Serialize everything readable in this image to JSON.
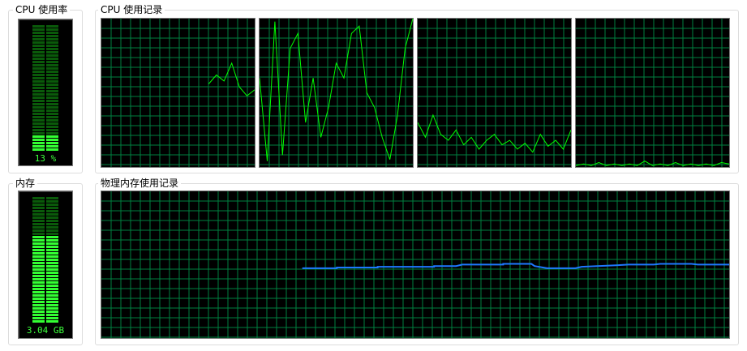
{
  "colors": {
    "background": "#000000",
    "grid": "#008040",
    "cpu_line": "#00ff00",
    "meter_on": "#33ff33",
    "meter_off": "#0a5a0a",
    "memory_line": "#1e78ff"
  },
  "cpu_usage": {
    "label": "CPU 使用率",
    "value_text": "13 %",
    "fraction": 0.13
  },
  "cpu_history": {
    "label": "CPU 使用记录"
  },
  "memory": {
    "label": "内存",
    "value_text": "3.04 GB",
    "fraction": 0.68
  },
  "memory_history": {
    "label": "物理内存使用记录"
  },
  "chart_data": [
    {
      "type": "line",
      "name": "cpu-core-1",
      "ylim": [
        0,
        100
      ],
      "x": [
        0,
        1,
        2,
        3,
        4,
        5,
        6,
        7,
        8,
        9,
        10,
        11,
        12,
        13,
        14,
        15,
        16,
        17,
        18,
        19,
        20
      ],
      "values": [
        null,
        null,
        null,
        null,
        null,
        null,
        null,
        null,
        null,
        null,
        null,
        null,
        null,
        null,
        56,
        62,
        58,
        70,
        54,
        48,
        52
      ]
    },
    {
      "type": "line",
      "name": "cpu-core-2",
      "ylim": [
        0,
        100
      ],
      "x": [
        0,
        1,
        2,
        3,
        4,
        5,
        6,
        7,
        8,
        9,
        10,
        11,
        12,
        13,
        14,
        15,
        16,
        17,
        18,
        19,
        20
      ],
      "values": [
        60,
        4,
        98,
        8,
        80,
        90,
        30,
        60,
        20,
        40,
        70,
        60,
        90,
        95,
        50,
        40,
        20,
        5,
        35,
        80,
        100
      ]
    },
    {
      "type": "line",
      "name": "cpu-core-3",
      "ylim": [
        0,
        100
      ],
      "x": [
        0,
        1,
        2,
        3,
        4,
        5,
        6,
        7,
        8,
        9,
        10,
        11,
        12,
        13,
        14,
        15,
        16,
        17,
        18,
        19,
        20
      ],
      "values": [
        30,
        20,
        35,
        22,
        18,
        25,
        15,
        20,
        12,
        18,
        22,
        15,
        18,
        12,
        16,
        10,
        22,
        14,
        18,
        12,
        25
      ]
    },
    {
      "type": "line",
      "name": "cpu-core-4",
      "ylim": [
        0,
        100
      ],
      "x": [
        0,
        1,
        2,
        3,
        4,
        5,
        6,
        7,
        8,
        9,
        10,
        11,
        12,
        13,
        14,
        15,
        16,
        17,
        18,
        19,
        20
      ],
      "values": [
        1,
        2,
        1,
        3,
        1,
        2,
        1,
        2,
        1,
        4,
        1,
        2,
        1,
        3,
        1,
        2,
        1,
        2,
        1,
        3,
        2
      ]
    },
    {
      "type": "line",
      "name": "physical-memory",
      "ylim": [
        0,
        100
      ],
      "x": [
        0,
        1,
        2,
        3,
        4,
        5,
        6,
        7,
        8,
        9,
        10,
        11,
        12,
        13,
        14,
        15,
        16,
        17,
        18,
        19,
        20,
        21,
        22,
        23,
        24,
        25,
        26,
        27,
        28,
        29,
        30,
        31,
        32,
        33,
        34,
        35,
        36,
        37,
        38,
        39,
        40
      ],
      "values": [
        null,
        null,
        null,
        null,
        null,
        null,
        null,
        null,
        null,
        null,
        null,
        null,
        null,
        null,
        null,
        null,
        null,
        null,
        null,
        null,
        null,
        null,
        null,
        null,
        null,
        null,
        null,
        null,
        null,
        null,
        null,
        null,
        null,
        null,
        null,
        null,
        null,
        null,
        null,
        null,
        null
      ]
    }
  ],
  "memory_series": {
    "x": [
      0,
      5,
      10,
      15,
      20,
      25,
      30,
      35,
      40,
      45,
      50,
      55,
      60,
      65,
      70,
      75,
      80,
      85,
      90,
      95,
      100
    ],
    "values": [
      null,
      null,
      null,
      null,
      null,
      null,
      null,
      null,
      null,
      null,
      null,
      null,
      null,
      null,
      null,
      null,
      null,
      null,
      null,
      null,
      null
    ]
  }
}
